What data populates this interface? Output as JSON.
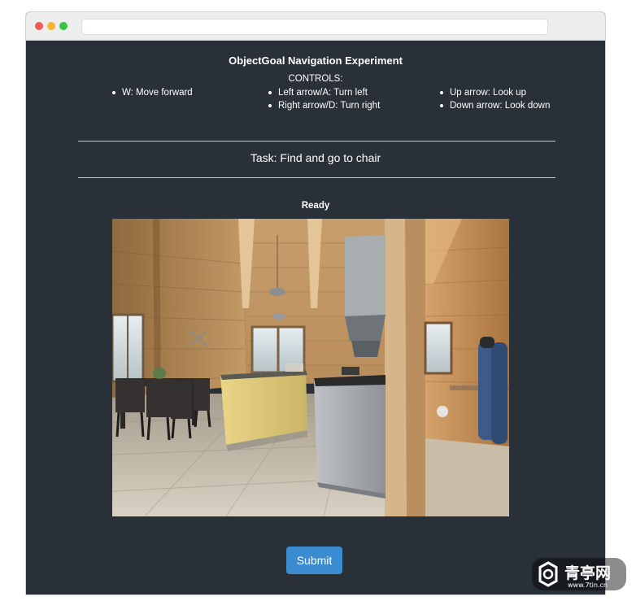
{
  "experiment": {
    "title": "ObjectGoal Navigation Experiment",
    "controls_label": "CONTROLS:",
    "controls": {
      "column1": [
        "W: Move forward"
      ],
      "column2": [
        "Left arrow/A: Turn left",
        "Right arrow/D: Turn right"
      ],
      "column3": [
        "Up arrow: Look up",
        "Down arrow: Look down"
      ]
    },
    "task": "Task: Find and go to chair",
    "status": "Ready",
    "submit_label": "Submit"
  },
  "watermark": {
    "brand": "青亭网",
    "url": "www.7tin.cn"
  },
  "colors": {
    "page_background": "#2a3038",
    "submit_button": "#3a8bd0",
    "titlebar": "#eceded"
  }
}
